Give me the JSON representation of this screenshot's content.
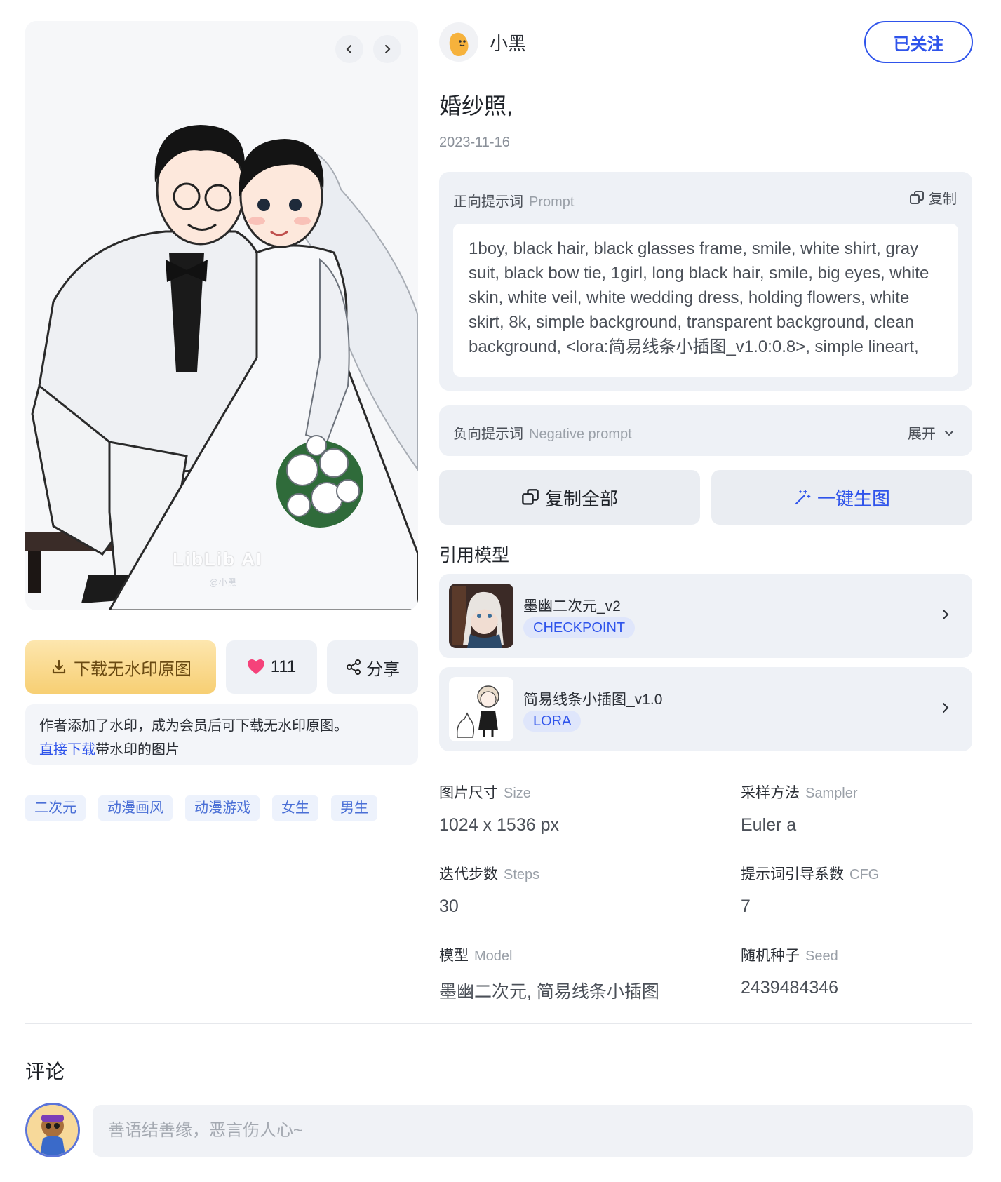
{
  "author": {
    "name": "小黑",
    "follow_label": "已关注"
  },
  "post": {
    "title": "婚纱照,",
    "date": "2023-11-16"
  },
  "image": {
    "watermark_logo": "LibLib AI",
    "watermark_user": "@小黑"
  },
  "actions": {
    "download_label": "下载无水印原图",
    "like_count": "111",
    "share_label": "分享"
  },
  "notice": {
    "text": "作者添加了水印，成为会员后可下载无水印原图。",
    "link_label": "直接下载",
    "link_suffix": "带水印的图片"
  },
  "tags": [
    "二次元",
    "动漫画风",
    "动漫游戏",
    "女生",
    "男生"
  ],
  "prompt": {
    "label": "正向提示词",
    "label_en": "Prompt",
    "copy_label": "复制",
    "text": "1boy, black hair, black glasses frame, smile, white shirt, gray suit, black bow tie, 1girl, long black hair, smile, big eyes, white skin, white veil, white wedding dress, holding flowers, white skirt, 8k, simple background, transparent background, clean background, <lora:简易线条小插图_v1.0:0.8>, simple lineart,"
  },
  "negative_prompt": {
    "label": "负向提示词",
    "label_en": "Negative prompt",
    "expand_label": "展开"
  },
  "buttons": {
    "copy_all": "复制全部",
    "generate": "一键生图"
  },
  "models_section": {
    "title": "引用模型",
    "items": [
      {
        "name": "墨幽二次元_v2",
        "type": "CHECKPOINT"
      },
      {
        "name": "简易线条小插图_v1.0",
        "type": "LORA"
      }
    ]
  },
  "params": [
    {
      "label": "图片尺寸",
      "label_en": "Size",
      "value": "1024 x 1536 px"
    },
    {
      "label": "采样方法",
      "label_en": "Sampler",
      "value": "Euler a"
    },
    {
      "label": "迭代步数",
      "label_en": "Steps",
      "value": "30"
    },
    {
      "label": "提示词引导系数",
      "label_en": "CFG",
      "value": "7"
    },
    {
      "label": "模型",
      "label_en": "Model",
      "value": "墨幽二次元, 简易线条小插图"
    },
    {
      "label": "随机种子",
      "label_en": "Seed",
      "value": "2439484346"
    }
  ],
  "comments": {
    "title": "评论",
    "placeholder": "善语结善缘，恶言伤人心~"
  },
  "colors": {
    "accent": "#2f54eb",
    "download_bg": "#fbd98a",
    "heart": "#f5427a"
  }
}
